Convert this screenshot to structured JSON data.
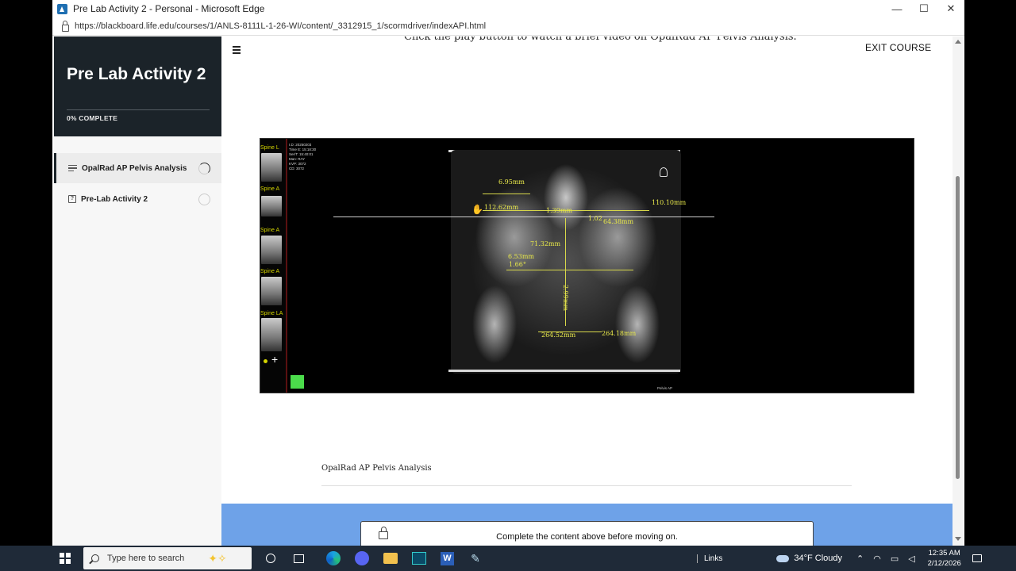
{
  "browser": {
    "window_title": "Pre Lab Activity 2 - Personal - Microsoft Edge",
    "url": "https://blackboard.life.edu/courses/1/ANLS-8111L-1-26-WI/content/_3312915_1/scormdriver/indexAPI.html",
    "minimize": "—",
    "maximize": "☐",
    "close": "✕"
  },
  "sidebar": {
    "course_title": "Pre Lab Activity 2",
    "progress_label": "0% COMPLETE",
    "progress_percent": 0,
    "lessons": [
      {
        "label": "OpalRad AP Pelvis Analysis",
        "status": "in-progress"
      },
      {
        "label": "Pre-Lab Activity 2",
        "status": "not-started"
      }
    ]
  },
  "main": {
    "top_text": "Click the play button to watch a brief video on OpalRad AP Pelvis Analysis.",
    "exit_label": "EXIT COURSE",
    "caption": "OpalRad AP Pelvis Analysis",
    "notice": "Complete the content above before moving on."
  },
  "video": {
    "thumb_labels": [
      "Spine L",
      "Spine A",
      "Spine A",
      "Spine A",
      "Spine LA"
    ],
    "measurements": [
      "6.95mm",
      "112.62mm",
      "1.39mm",
      "110.10mm",
      "1.02",
      "64.38mm",
      "71.32mm",
      "6.53mm",
      "1.66°",
      "2.99mm",
      "264.52mm",
      "264.18mm"
    ],
    "corner_tag": "Pelvis AP",
    "info_lines": [
      "I.D: 20250203",
      "Time E: 15:18:30",
      "Ser/T: 15:40:01",
      "Man: RAY",
      "KVP: 3072",
      "CD: 3072"
    ]
  },
  "taskbar": {
    "search_placeholder": "Type here to search",
    "word_letter": "W",
    "links_label": "Links",
    "weather": "34°F  Cloudy",
    "time": "12:35 AM",
    "date": "2/12/2026"
  },
  "colors": {
    "sidebar_header": "#1b2329",
    "footer_blue": "#6ea2e8",
    "taskbar": "#1f2a38"
  }
}
